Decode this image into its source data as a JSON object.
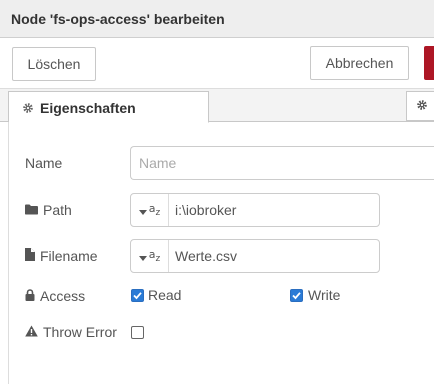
{
  "window": {
    "title": "Node 'fs-ops-access' bearbeiten"
  },
  "toolbar": {
    "delete_label": "Löschen",
    "cancel_label": "Abbrechen"
  },
  "tabs": {
    "properties_label": "Eigenschaften"
  },
  "form": {
    "name": {
      "label": "Name",
      "placeholder": "Name",
      "value": ""
    },
    "path": {
      "label": "Path",
      "type_icon": "az-string-icon",
      "value": "i:\\iobroker"
    },
    "filename": {
      "label": "Filename",
      "type_icon": "az-string-icon",
      "value": "Werte.csv"
    },
    "access": {
      "label": "Access",
      "read_label": "Read",
      "read_checked": true,
      "write_label": "Write",
      "write_checked": true
    },
    "throw_error": {
      "label": "Throw Error",
      "checked": false
    }
  },
  "colors": {
    "done_button": "#ad1625",
    "checkbox_checked": "#2a7bd6"
  }
}
